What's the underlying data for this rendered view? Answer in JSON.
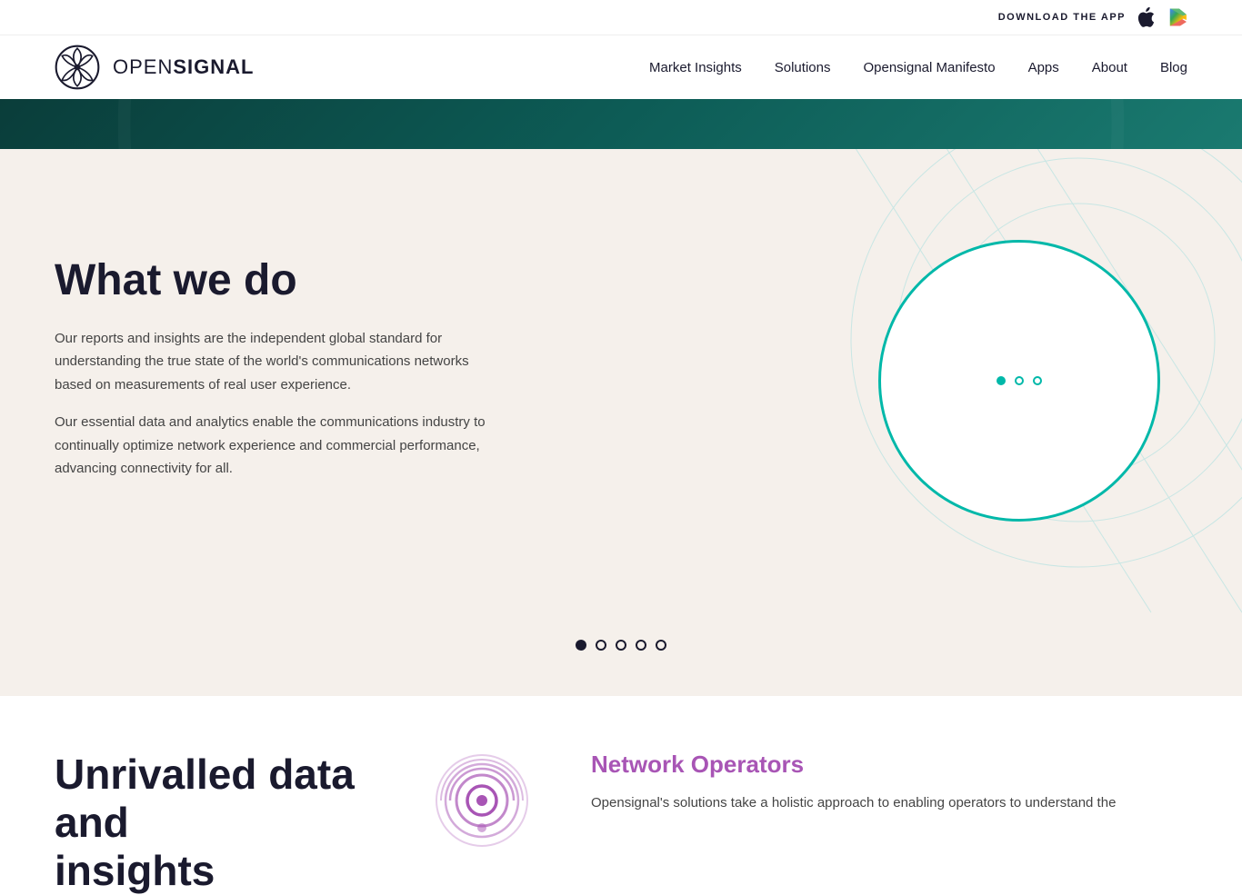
{
  "header": {
    "download_label": "DOWNLOAD THE APP",
    "logo_text_light": "OPEN",
    "logo_text_bold": "SIGNAL",
    "nav": {
      "items": [
        {
          "label": "Market Insights",
          "id": "market-insights"
        },
        {
          "label": "Solutions",
          "id": "solutions"
        },
        {
          "label": "Opensignal Manifesto",
          "id": "manifesto"
        },
        {
          "label": "Apps",
          "id": "apps"
        },
        {
          "label": "About",
          "id": "about"
        },
        {
          "label": "Blog",
          "id": "blog"
        }
      ]
    }
  },
  "what_we_do": {
    "title": "What we do",
    "paragraph1": "Our reports and insights are the independent global standard for understanding the true state of the world's communications networks based on measurements of real user experience.",
    "paragraph2": "Our essential data and analytics enable the communications industry to continually optimize network experience and commercial performance, advancing connectivity for all."
  },
  "carousel": {
    "dots": [
      {
        "active": true
      },
      {
        "active": false
      },
      {
        "active": false
      },
      {
        "active": false
      },
      {
        "active": false
      }
    ]
  },
  "bottom": {
    "title_line1": "Unrivalled data and",
    "title_line2": "insights"
  },
  "network_operators": {
    "title": "Network Operators",
    "description": "Opensignal's solutions take a holistic approach to enabling operators to understand the"
  },
  "colors": {
    "teal": "#00b8a9",
    "purple": "#a855b5",
    "dark": "#1a1a2e",
    "bg": "#f5f0eb"
  }
}
